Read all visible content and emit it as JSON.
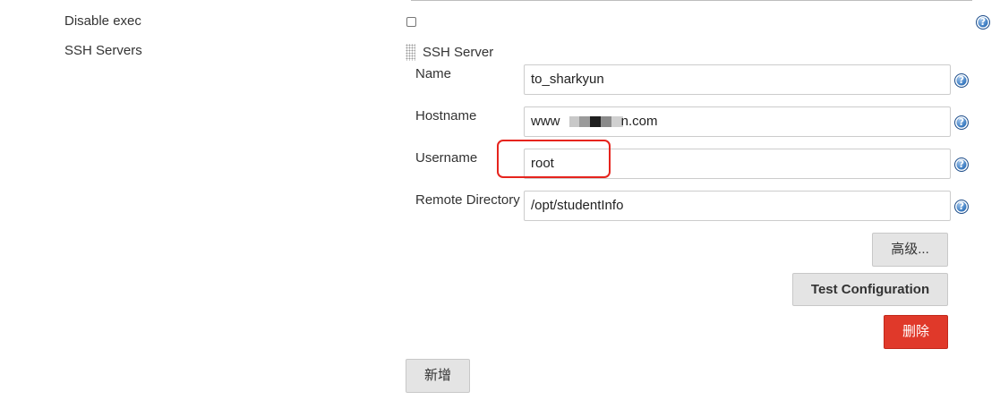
{
  "fields": {
    "disable_exec": {
      "label": "Disable exec",
      "checked": false
    },
    "ssh_servers": {
      "label": "SSH Servers"
    }
  },
  "ssh_server": {
    "title": "SSH Server",
    "name": {
      "label": "Name",
      "value": "to_sharkyun"
    },
    "hostname": {
      "label": "Hostname",
      "value_prefix": "www",
      "value_suffix": ".com",
      "value_visible_tail": "n"
    },
    "username": {
      "label": "Username",
      "value": "root"
    },
    "remote_directory": {
      "label": "Remote Directory",
      "value": "/opt/studentInfo"
    }
  },
  "buttons": {
    "advanced": "高级...",
    "test_configuration": "Test Configuration",
    "delete": "删除",
    "add": "新增"
  },
  "help_icon_glyph": "?",
  "colors": {
    "highlight": "#e6241d",
    "danger": "#e0392a",
    "help": "#3f7fc4"
  }
}
